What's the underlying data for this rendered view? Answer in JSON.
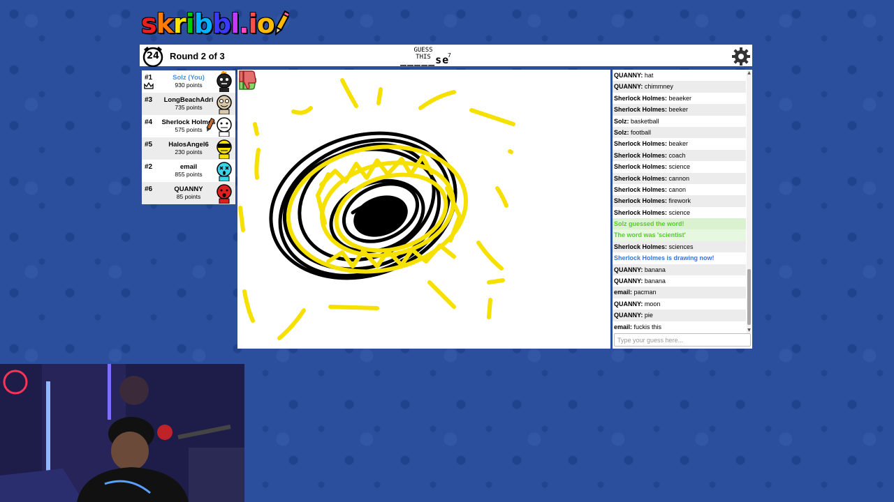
{
  "logo": {
    "text": "skribbl.io"
  },
  "topbar": {
    "timer": "24",
    "round_text": "Round 2 of 3",
    "guess_label": "GUESS THIS",
    "word_hint": "_____se",
    "word_length": "7"
  },
  "players": [
    {
      "rank": "#1",
      "name": "Solz (You)",
      "points": "930 points",
      "is_you": true
    },
    {
      "rank": "#3",
      "name": "LongBeachAdri",
      "points": "735 points"
    },
    {
      "rank": "#4",
      "name": "Sherlock Holmes",
      "points": "575 points",
      "drawing": true
    },
    {
      "rank": "#5",
      "name": "HalosAngel6",
      "points": "230 points"
    },
    {
      "rank": "#2",
      "name": "email",
      "points": "855 points"
    },
    {
      "rank": "#6",
      "name": "QUANNY",
      "points": "85 points"
    }
  ],
  "chat": {
    "messages": [
      {
        "name": "QUANNY:",
        "text": " hat"
      },
      {
        "name": "QUANNY:",
        "text": " chimmney"
      },
      {
        "name": "Sherlock Holmes:",
        "text": " beaeker"
      },
      {
        "name": "Sherlock Holmes:",
        "text": " beeker"
      },
      {
        "name": "Solz:",
        "text": " basketball"
      },
      {
        "name": "Solz:",
        "text": " football"
      },
      {
        "name": "Sherlock Holmes:",
        "text": " beaker"
      },
      {
        "name": "Sherlock Holmes:",
        "text": " coach"
      },
      {
        "name": "Sherlock Holmes:",
        "text": " science"
      },
      {
        "name": "Sherlock Holmes:",
        "text": " cannon"
      },
      {
        "name": "Sherlock Holmes:",
        "text": " canon"
      },
      {
        "name": "Sherlock Holmes:",
        "text": " firework"
      },
      {
        "name": "Sherlock Holmes:",
        "text": " science"
      },
      {
        "system": "success",
        "text": "Solz guessed the word!"
      },
      {
        "system": "success",
        "text": "The word was 'scientist'"
      },
      {
        "name": "Sherlock Holmes:",
        "text": " sciences"
      },
      {
        "system": "info",
        "text": "Sherlock Holmes is drawing now!"
      },
      {
        "name": "QUANNY:",
        "text": " banana"
      },
      {
        "name": "QUANNY:",
        "text": " banana"
      },
      {
        "name": "email:",
        "text": " pacman"
      },
      {
        "name": "QUANNY:",
        "text": " moon"
      },
      {
        "name": "QUANNY:",
        "text": " pie"
      },
      {
        "name": "email:",
        "text": " fuckis this"
      }
    ],
    "input_placeholder": "Type your guess here..."
  },
  "colors": {
    "background": "#2b4f9c",
    "you_name": "#4a90d9",
    "success_text": "#56ce27",
    "info_text": "#3975ce",
    "drawing_yellow": "#f5e000",
    "drawing_black": "#000000"
  },
  "icons": {
    "timer": "alarm-clock-icon",
    "settings": "gear-icon",
    "like": "thumbs-up-icon",
    "dislike": "thumbs-down-icon",
    "owner": "crown-icon",
    "drawer": "pencil-icon"
  }
}
